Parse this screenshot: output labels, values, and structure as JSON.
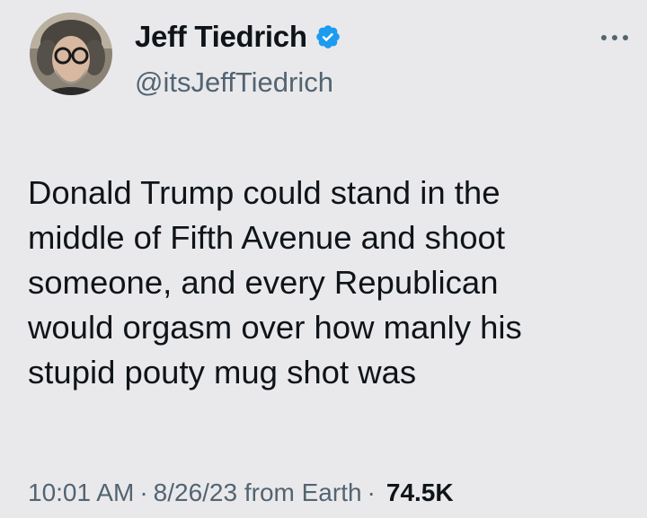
{
  "author": {
    "name": "Jeff Tiedrich",
    "handle": "@itsJeffTiedrich",
    "verified": true
  },
  "tweet": {
    "text": "Donald Trump could stand in the\nmiddle of Fifth Avenue and shoot\nsomeone, and every Republican\nwould orgasm over how manly his\nstupid pouty mug shot was"
  },
  "meta": {
    "time": "10:01 AM",
    "separator": "·",
    "date": "8/26/23",
    "source": "from Earth",
    "views": "74.5K"
  },
  "icons": {
    "verified": "verified-badge-icon",
    "more": "more-options-icon"
  },
  "colors": {
    "background": "#e9e9ec",
    "primary_text": "#0f1419",
    "secondary_text": "#536471",
    "verified_blue": "#1d9bf0"
  }
}
